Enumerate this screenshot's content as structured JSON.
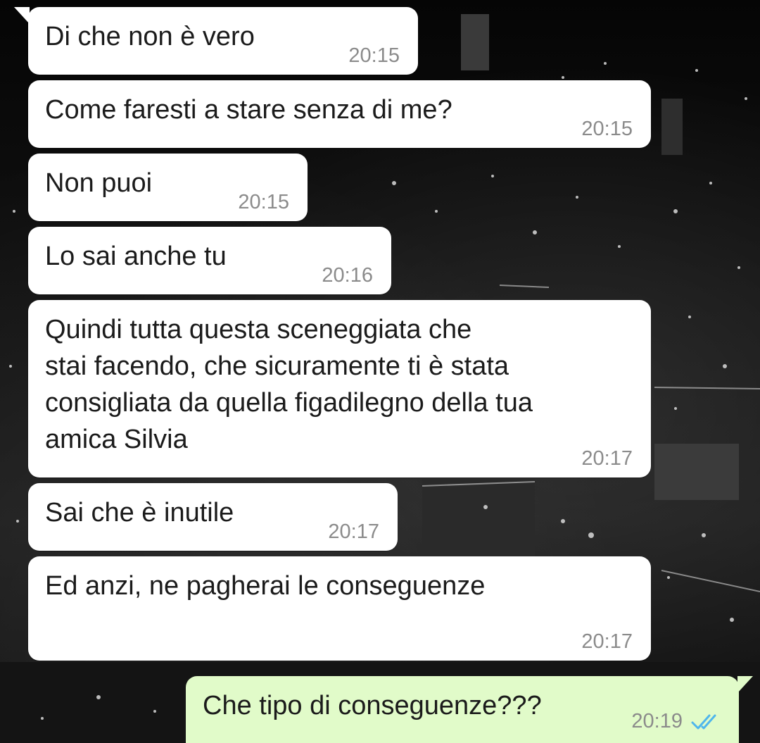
{
  "wallpaper": {
    "icon": "city-night-wallpaper"
  },
  "messages": [
    {
      "text": "Di che non è vero",
      "time": "20:15",
      "direction": "incoming"
    },
    {
      "text": "Come faresti a stare senza di me?",
      "time": "20:15",
      "direction": "incoming"
    },
    {
      "text": "Non puoi",
      "time": "20:15",
      "direction": "incoming"
    },
    {
      "text": "Lo sai anche tu",
      "time": "20:16",
      "direction": "incoming"
    },
    {
      "text": "Quindi tutta questa sceneggiata che\nstai facendo, che sicuramente ti è stata\nconsigliata da quella figadilegno della tua\namica Silvia",
      "time": "20:17",
      "direction": "incoming"
    },
    {
      "text": "Sai che è inutile",
      "time": "20:17",
      "direction": "incoming"
    },
    {
      "text": "Ed anzi, ne pagherai le conseguenze",
      "time": "20:17",
      "direction": "incoming"
    },
    {
      "text": "Che tipo di conseguenze???",
      "time": "20:19",
      "direction": "outgoing",
      "status_icon": "read-double-check-icon"
    }
  ],
  "colors": {
    "incoming_bubble": "#ffffff",
    "outgoing_bubble": "#e1fbc9",
    "read_ticks": "#4fb6ec",
    "timestamp": "#8b8b8b"
  }
}
